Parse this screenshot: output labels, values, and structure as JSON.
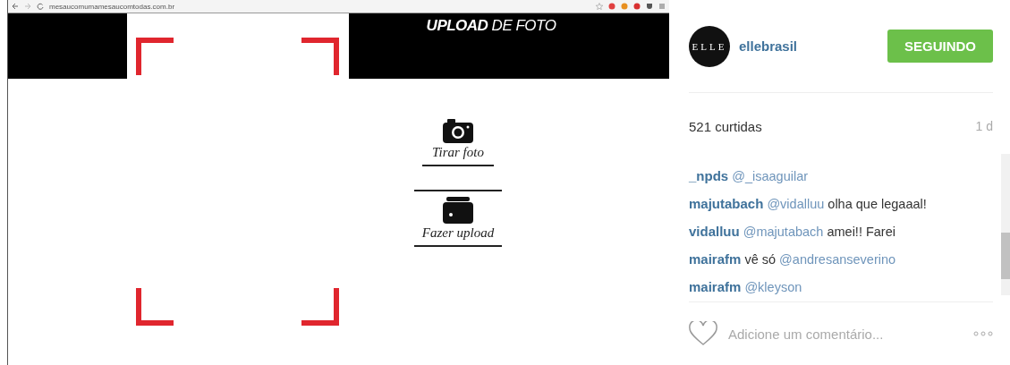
{
  "browser": {
    "url": "mesaucomumamesaucomtodas.com.br"
  },
  "upload_page": {
    "title": "**UPLOAD** DE FOTO",
    "options": [
      {
        "kind": "camera",
        "label": "Tirar foto"
      },
      {
        "kind": "folder",
        "label": "Fazer upload"
      }
    ]
  },
  "post": {
    "avatar_text": "ELLE",
    "username": "ellebrasil",
    "follow_button": "SEGUINDO",
    "likes": "521 curtidas",
    "age": "1 d",
    "comments": [
      {
        "user": "_npds",
        "parts": [
          {
            "kind": "mention",
            "text": "@_isaaguilar"
          }
        ]
      },
      {
        "user": "majutabach",
        "parts": [
          {
            "kind": "mention",
            "text": "@vidalluu"
          },
          {
            "kind": "text",
            "text": "olha que legaaal!"
          }
        ]
      },
      {
        "user": "vidalluu",
        "parts": [
          {
            "kind": "mention",
            "text": "@majutabach"
          },
          {
            "kind": "text",
            "text": "amei!! Farei"
          }
        ]
      },
      {
        "user": "mairafm",
        "parts": [
          {
            "kind": "text",
            "text": "vê só"
          },
          {
            "kind": "mention",
            "text": "@andresanseverino"
          }
        ]
      },
      {
        "user": "mairafm",
        "parts": [
          {
            "kind": "mention",
            "text": "@kleyson"
          }
        ]
      }
    ],
    "comment_placeholder": "Adicione um comentário...",
    "liked": false
  }
}
